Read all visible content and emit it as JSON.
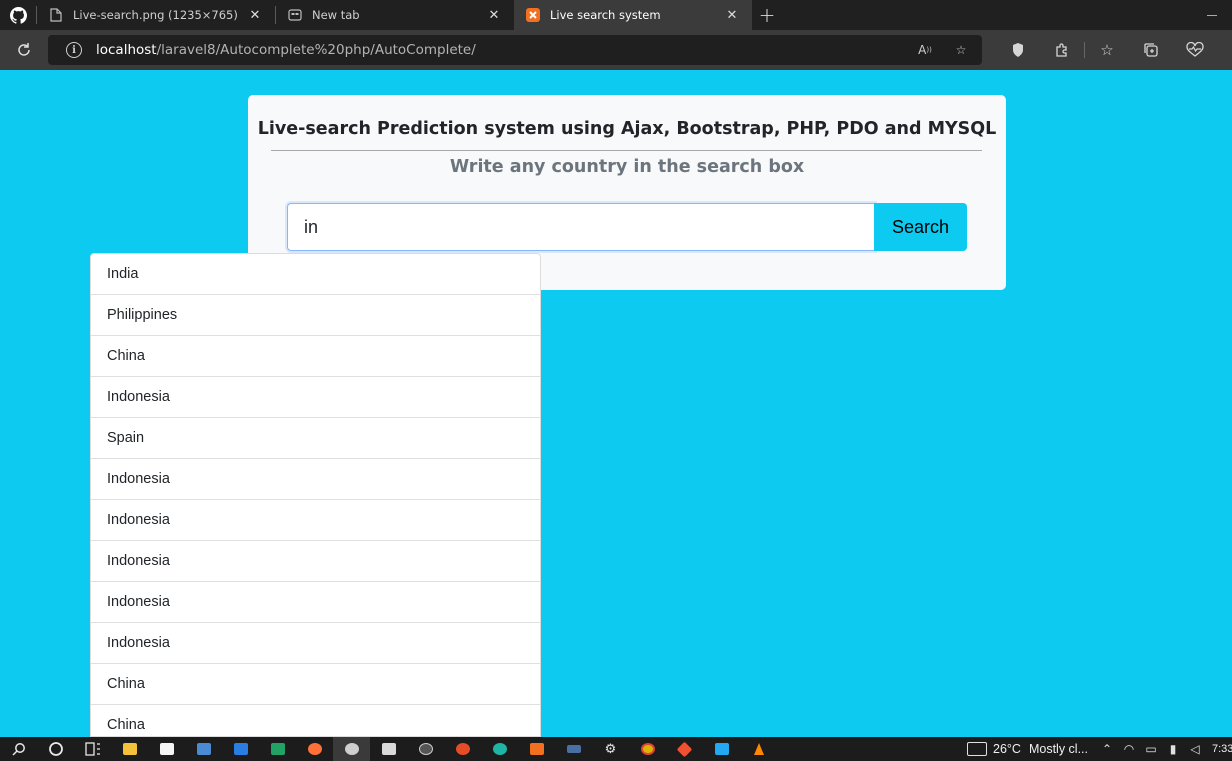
{
  "browser": {
    "tabs": [
      {
        "title": "Live-search.png (1235×765)",
        "icon": "file-icon",
        "active": false
      },
      {
        "title": "New tab",
        "icon": "newtab-icon",
        "active": false
      },
      {
        "title": "Live search system",
        "icon": "xampp-icon",
        "active": true
      }
    ],
    "new_tab_label": "+",
    "close_glyph": "✕",
    "url_host": "localhost",
    "url_path": "/laravel8/Autocomplete%20php/AutoComplete/",
    "accent": "#0dcaf0"
  },
  "page": {
    "heading": "Live-search Prediction system using Ajax, Bootstrap, PHP, PDO and MYSQL",
    "subheading": "Write any country in the search box",
    "search": {
      "value": "in",
      "button_label": "Search"
    },
    "suggestions": [
      "India",
      "Philippines",
      "China",
      "Indonesia",
      "Spain",
      "Indonesia",
      "Indonesia",
      "Indonesia",
      "Indonesia",
      "Indonesia",
      "China",
      "China"
    ]
  },
  "taskbar": {
    "weather_temp": "26°C",
    "weather_text": "Mostly cl...",
    "clock": "7:33"
  }
}
